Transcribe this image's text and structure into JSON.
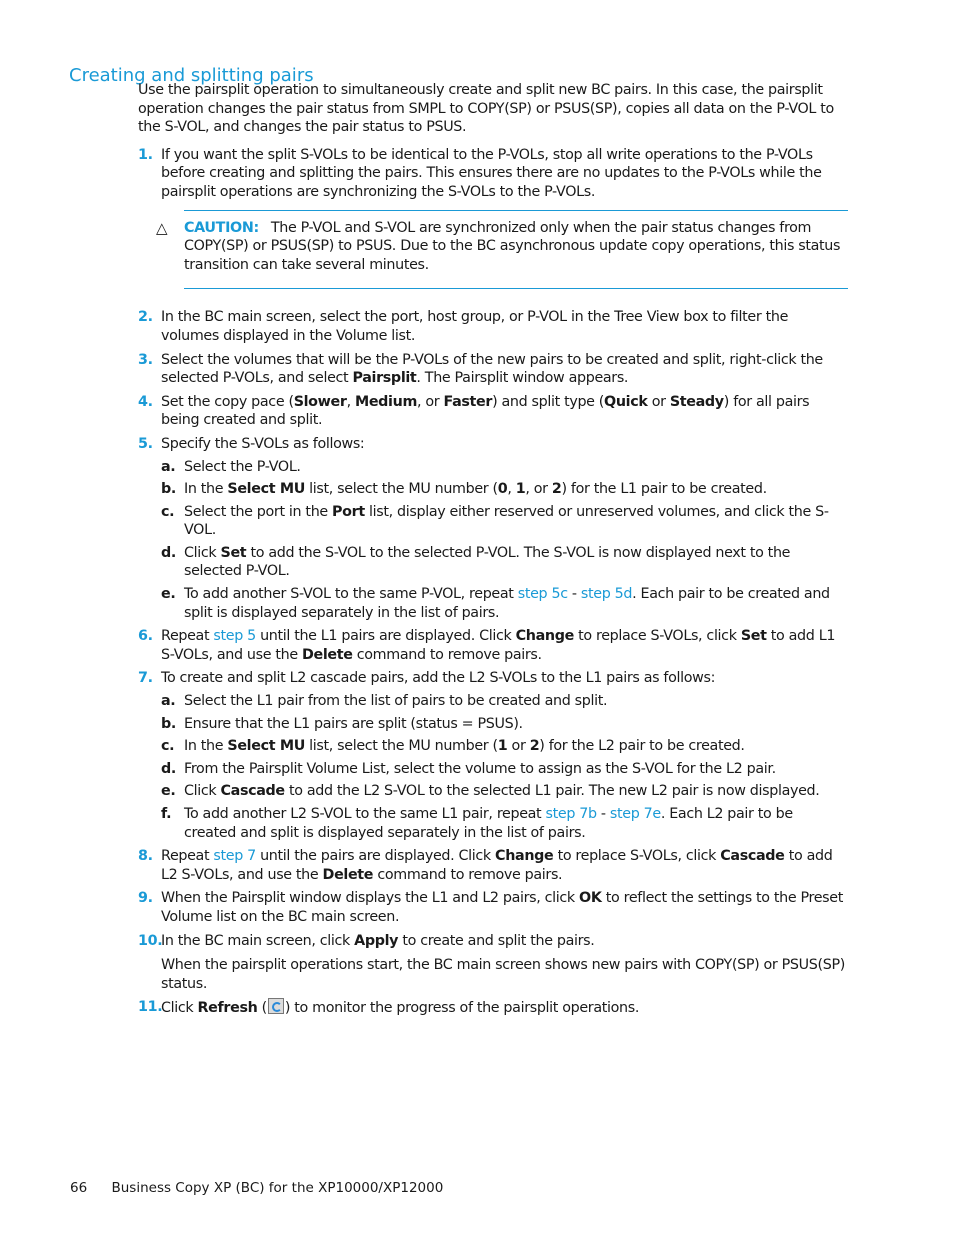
{
  "title": "Creating and splitting pairs",
  "intro": "Use the pairsplit operation to simultaneously create and split new BC pairs. In this case, the pairsplit operation changes the pair status from SMPL to COPY(SP) or PSUS(SP), copies all data on the P-VOL to the S-VOL, and changes the pair status to PSUS.",
  "step1": {
    "num": "1.",
    "text": "If you want the split S-VOLs to be identical to the P-VOLs, stop all write operations to the P-VOLs before creating and splitting the pairs. This ensures there are no updates to the P-VOLs while the pairsplit operations are synchronizing the S-VOLs to the P-VOLs."
  },
  "caution": {
    "label": "CAUTION:",
    "text": "The P-VOL and S-VOL are synchronized only when the pair status changes from COPY(SP) or PSUS(SP) to PSUS. Due to the BC asynchronous update copy operations, this status transition can take several minutes."
  },
  "step2": {
    "num": "2.",
    "text": "In the BC main screen, select the port, host group, or P-VOL in the Tree View box to filter the volumes displayed in the Volume list."
  },
  "step3": {
    "num": "3.",
    "t1": "Select the volumes that will be the P-VOLs of the new pairs to be created and split, right-click the selected P-VOLs, and select ",
    "b1": "Pairsplit",
    "t2": ". The Pairsplit window appears."
  },
  "step4": {
    "num": "4.",
    "t1": "Set the copy pace (",
    "b1": "Slower",
    "t2": ", ",
    "b2": "Medium",
    "t3": ", or ",
    "b3": "Faster",
    "t4": ") and split type (",
    "b4": "Quick",
    "t5": " or ",
    "b5": "Steady",
    "t6": ") for all pairs being created and split."
  },
  "step5": {
    "num": "5.",
    "text": "Specify the S-VOLs as follows:",
    "a": {
      "letter": "a.",
      "text": "Select the P-VOL."
    },
    "b": {
      "letter": "b.",
      "t1": "In the ",
      "b1": "Select MU",
      "t2": " list, select the MU number (",
      "b2": "0",
      "t3": ", ",
      "b3": "1",
      "t4": ", or ",
      "b4": "2",
      "t5": ") for the L1 pair to be created."
    },
    "c": {
      "letter": "c.",
      "t1": "Select the port in the ",
      "b1": "Port",
      "t2": " list, display either reserved or unreserved volumes, and click the S-VOL."
    },
    "d": {
      "letter": "d.",
      "t1": "Click ",
      "b1": "Set",
      "t2": " to add the S-VOL to the selected P-VOL. The S-VOL is now displayed next to the selected P-VOL."
    },
    "e": {
      "letter": "e.",
      "t1": "To add another S-VOL to the same P-VOL, repeat ",
      "l1": "step 5c",
      "t2": " - ",
      "l2": "step 5d",
      "t3": ". Each pair to be created and split is displayed separately in the list of pairs."
    }
  },
  "step6": {
    "num": "6.",
    "t1": "Repeat ",
    "l1": "step 5",
    "t2": " until the L1 pairs are displayed. Click ",
    "b1": "Change",
    "t3": " to replace S-VOLs, click ",
    "b2": "Set",
    "t4": " to add L1 S-VOLs, and use the ",
    "b3": "Delete",
    "t5": " command to remove pairs."
  },
  "step7": {
    "num": "7.",
    "text": "To create and split L2 cascade pairs, add the L2 S-VOLs to the L1 pairs as follows:",
    "a": {
      "letter": "a.",
      "text": "Select the L1 pair from the list of pairs to be created and split."
    },
    "b": {
      "letter": "b.",
      "text": "Ensure that the L1 pairs are split (status = PSUS)."
    },
    "c": {
      "letter": "c.",
      "t1": "In the ",
      "b1": "Select MU",
      "t2": " list, select the MU number (",
      "b2": "1",
      "t3": " or ",
      "b3": "2",
      "t4": ") for the L2 pair to be created."
    },
    "d": {
      "letter": "d.",
      "text": "From the Pairsplit Volume List, select the volume to assign as the S-VOL for the L2 pair."
    },
    "e": {
      "letter": "e.",
      "t1": "Click ",
      "b1": "Cascade",
      "t2": " to add the L2 S-VOL to the selected L1 pair. The new L2 pair is now displayed."
    },
    "f": {
      "letter": "f.",
      "t1": "To add another L2 S-VOL to the same L1 pair, repeat ",
      "l1": "step 7b",
      "t2": " - ",
      "l2": "step 7e",
      "t3": ". Each L2 pair to be created and split is displayed separately in the list of pairs."
    }
  },
  "step8": {
    "num": "8.",
    "t1": "Repeat ",
    "l1": "step 7",
    "t2": " until the pairs are displayed. Click ",
    "b1": "Change",
    "t3": " to replace S-VOLs, click ",
    "b2": "Cascade",
    "t4": " to add L2 S-VOLs, and use the ",
    "b3": "Delete",
    "t5": " command to remove pairs."
  },
  "step9": {
    "num": "9.",
    "t1": "When the Pairsplit window displays the L1 and L2 pairs, click ",
    "b1": "OK",
    "t2": " to reflect the settings to the Preset Volume list on the BC main screen."
  },
  "step10": {
    "num": "10.",
    "t1": "In the BC main screen, click ",
    "b1": "Apply",
    "t2": " to create and split the pairs.",
    "follow": "When the pairsplit operations start, the BC main screen shows new pairs with COPY(SP) or PSUS(SP) status."
  },
  "step11": {
    "num": "11.",
    "t1": "Click ",
    "b1": "Refresh",
    "t2": " (",
    "icon": "refresh-icon",
    "t3": ") to monitor the progress of the pairsplit operations."
  },
  "footer": {
    "page": "66",
    "text": "Business Copy XP (BC) for the XP10000/XP12000"
  }
}
